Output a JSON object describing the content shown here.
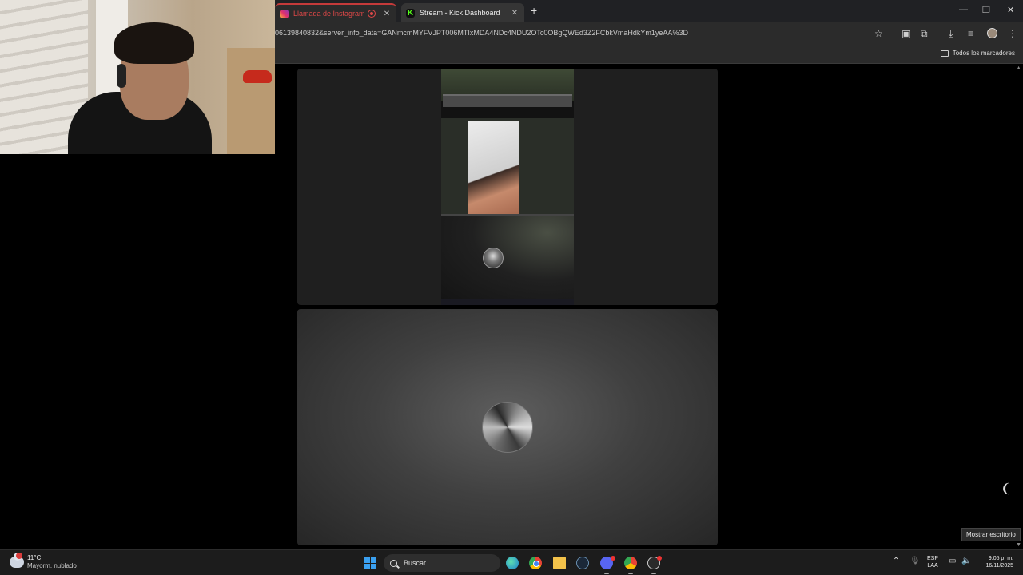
{
  "browser": {
    "tabs": [
      {
        "label": "Llamada de Instagram",
        "icon": "instagram-icon",
        "recording": true
      },
      {
        "label": "Stream - Kick Dashboard",
        "icon": "kick-icon"
      }
    ],
    "new_tab_glyph": "+",
    "url": "06139840832&server_info_data=GANmcmMYFVJPT006MTIxMDA4NDc4NDU2OTc0OBgQWEd3Z2FCbkVmaHdkYm1yeAA%3D",
    "bookmarks_label": "Todos los marcadores"
  },
  "call": {
    "remote_tile_kind": "screen-share",
    "local_tile_kind": "avatar"
  },
  "desktop": {
    "tooltip": "Mostrar escritorio"
  },
  "taskbar": {
    "weather": {
      "temp": "11°C",
      "desc": "Mayorm. nublado"
    },
    "search_placeholder": "Buscar",
    "language": {
      "code": "ESP",
      "layout": "LAA"
    },
    "time": "9:05 p. m.",
    "date": "16/11/2025"
  },
  "colors": {
    "accent_recording": "#e04848",
    "kick_green": "#53fc18",
    "windows_blue": "#3aa0f0"
  }
}
